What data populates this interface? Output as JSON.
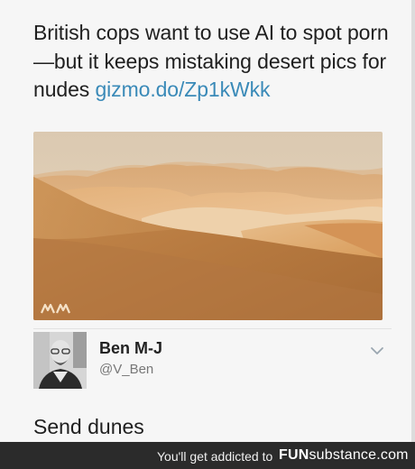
{
  "tweet": {
    "text": "British cops want to use AI to spot porn—but it keeps mistaking desert pics for nudes",
    "link": "gizmo.do/Zp1kWkk",
    "link_color": "#3a8ab8"
  },
  "media": {
    "icon": "desert-dunes-image",
    "watermark_icon": "double-m-watermark-icon"
  },
  "reply": {
    "author_name": "Ben M-J",
    "author_handle": "@V_Ben",
    "text": "Send dunes",
    "menu_icon": "chevron-down-icon"
  },
  "footer": {
    "tagline": "You'll get addicted to",
    "brand_fun": "FUN",
    "brand_rest": "substance",
    "brand_suffix": ".com",
    "background": "#2b2b2b"
  }
}
